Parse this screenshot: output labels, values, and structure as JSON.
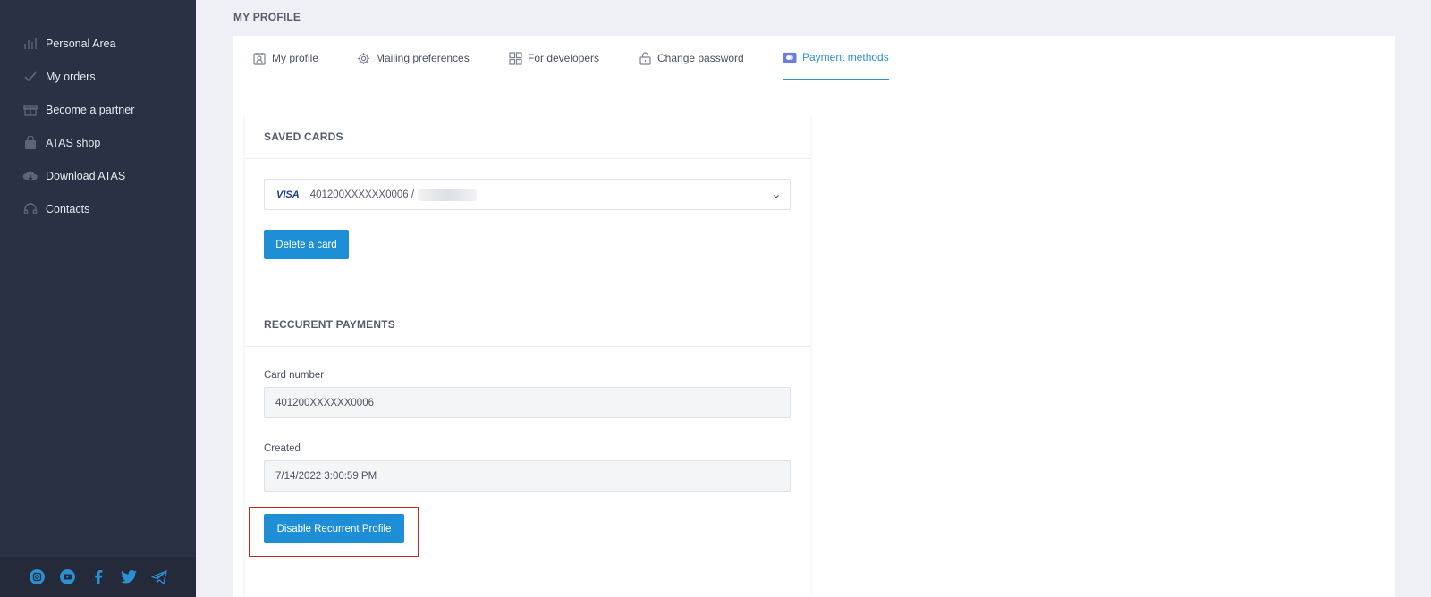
{
  "sidebar": {
    "items": [
      {
        "label": "Personal Area",
        "icon": "bar-chart-icon"
      },
      {
        "label": "My orders",
        "icon": "checkmark-icon"
      },
      {
        "label": "Become a partner",
        "icon": "gift-icon"
      },
      {
        "label": "ATAS shop",
        "icon": "shopping-bag-icon"
      },
      {
        "label": "Download ATAS",
        "icon": "cloud-download-icon"
      },
      {
        "label": "Contacts",
        "icon": "headset-icon"
      }
    ],
    "social": [
      "instagram-icon",
      "youtube-icon",
      "facebook-icon",
      "twitter-icon",
      "telegram-icon"
    ]
  },
  "page": {
    "title": "MY PROFILE"
  },
  "tabs": [
    {
      "label": "My profile",
      "icon": "profile-card-icon"
    },
    {
      "label": "Mailing preferences",
      "icon": "gear-icon"
    },
    {
      "label": "For developers",
      "icon": "grid-icon"
    },
    {
      "label": "Change password",
      "icon": "lock-icon"
    },
    {
      "label": "Payment methods",
      "icon": "credit-card-icon",
      "active": true
    }
  ],
  "saved_cards": {
    "title": "SAVED CARDS",
    "brand": "VISA",
    "selected_card": "401200XXXXXX0006 /",
    "delete_label": "Delete a card"
  },
  "recurrent": {
    "title": "RECCURENT PAYMENTS",
    "card_number_label": "Card number",
    "card_number_value": "401200XXXXXX0006",
    "created_label": "Created",
    "created_value": "7/14/2022 3:00:59 PM",
    "disable_label": "Disable Recurrent Profile"
  },
  "colors": {
    "accent": "#1e8fd6",
    "sidebar_bg": "#2b3144",
    "highlight": "#c62828"
  }
}
